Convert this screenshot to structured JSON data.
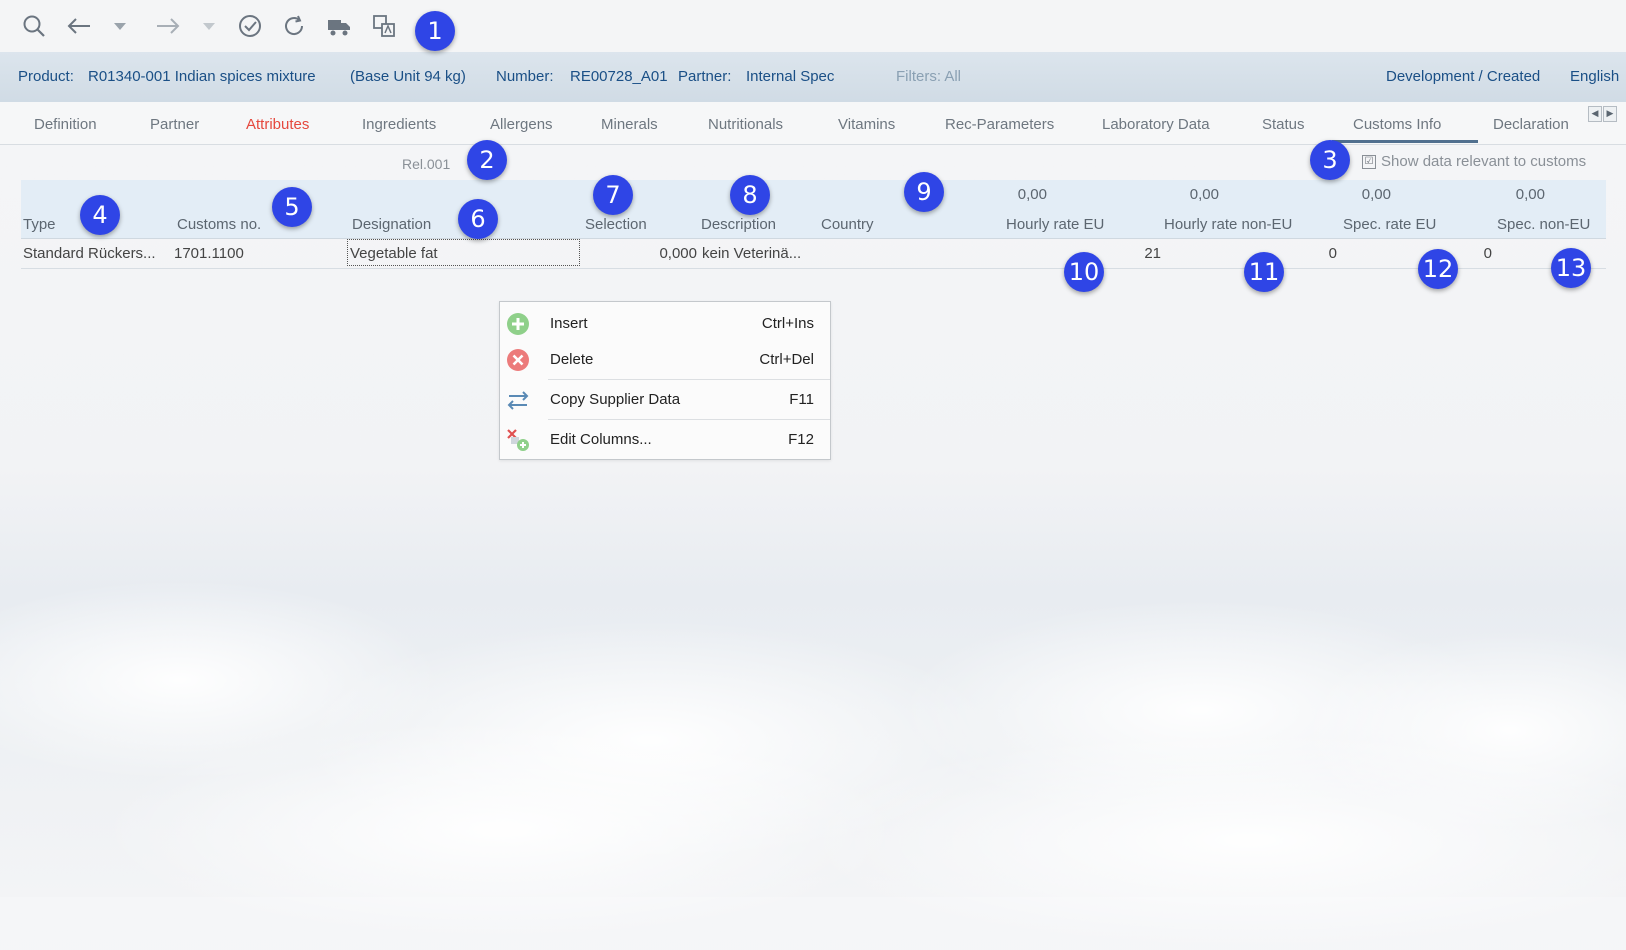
{
  "colors": {
    "accent_red": "#e5483d",
    "info_blue": "#1a4f86",
    "badge_blue": "#2f45e6"
  },
  "toolbar": {
    "icons": [
      "search-icon",
      "back-arrow-icon",
      "dropdown-icon",
      "forward-arrow-icon",
      "dropdown-icon",
      "check-circle-icon",
      "refresh-icon",
      "truck-icon",
      "translate-icon"
    ]
  },
  "info": {
    "product_label": "Product:",
    "product_value": "R01340-001 Indian spices mixture",
    "base_unit": "(Base Unit 94 kg)",
    "number_label": "Number:",
    "number_value": "RE00728_A01",
    "partner_label": "Partner:",
    "partner_value": "Internal Spec",
    "filters": "Filters: All",
    "status": "Development / Created",
    "language": "English"
  },
  "tabs": [
    {
      "label": "Definition"
    },
    {
      "label": "Partner"
    },
    {
      "label": "Attributes"
    },
    {
      "label": "Ingredients"
    },
    {
      "label": "Allergens"
    },
    {
      "label": "Minerals"
    },
    {
      "label": "Nutritionals"
    },
    {
      "label": "Vitamins"
    },
    {
      "label": "Rec-Parameters"
    },
    {
      "label": "Laboratory Data"
    },
    {
      "label": "Status"
    },
    {
      "label": "Customs Info"
    },
    {
      "label": "Declaration"
    }
  ],
  "sub": {
    "rel": "Rel.001",
    "show_customs": "Show data relevant to customs",
    "checkbox": "☑"
  },
  "table": {
    "sums": [
      "0,00",
      "0,00",
      "0,00",
      "0,00"
    ],
    "headers": [
      "Type",
      "Customs no.",
      "Designation",
      "Selection",
      "Description",
      "Country",
      "Hourly rate EU",
      "Hourly rate non-EU",
      "Spec. rate EU",
      "Spec. non-EU"
    ],
    "row": [
      "Standard Rückers...",
      "1701.1100",
      "Vegetable fat",
      "0,000",
      "kein Veterinä...",
      "",
      "",
      "21",
      "0",
      "0"
    ]
  },
  "menu": [
    {
      "label": "Insert",
      "shortcut": "Ctrl+Ins",
      "icon": "plus-circle-icon"
    },
    {
      "label": "Delete",
      "shortcut": "Ctrl+Del",
      "icon": "x-circle-icon"
    },
    {
      "label": "Copy Supplier Data",
      "shortcut": "F11",
      "icon": "swap-arrows-icon"
    },
    {
      "label": "Edit Columns...",
      "shortcut": "F12",
      "icon": "edit-columns-icon"
    }
  ],
  "badges": [
    "1",
    "2",
    "3",
    "4",
    "5",
    "6",
    "7",
    "8",
    "9",
    "10",
    "11",
    "12",
    "13"
  ]
}
